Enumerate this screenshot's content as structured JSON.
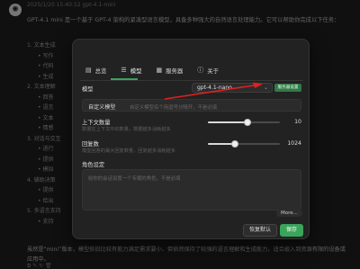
{
  "chat": {
    "meta": "2025/1/20 15:40:12   gpt-4.1-mini",
    "intro": "GPT-4.1 mini 是一个基于 GPT-4 架构的紧凑型语言模型，具备多种强大的自然语言处理能力。它可以帮助你完成以下任务：",
    "section_items": [
      "1. 文本生成",
      "• 写作",
      "• 代码",
      "• 生成",
      "2. 文本理解",
      "• 回答",
      "• 语言",
      "• 文本",
      "• 情感",
      "3. 对话与交互",
      "• 进行",
      "• 提供",
      "• 模拟",
      "4. 辅助决策",
      "• 提供",
      "• 给出",
      "5. 多语言支持",
      "• 支持"
    ],
    "outro": "虽然是“mini”版本，模型依旧比较有能力满足需求要小、但依然保持了较强的语言理解和生成能力，适合嵌入到资源有限的设备或应用中。"
  },
  "dialog": {
    "tabs": [
      {
        "label": "总览",
        "icon": "file-icon"
      },
      {
        "label": "模型",
        "icon": "sliders-icon"
      },
      {
        "label": "服务器",
        "icon": "server-icon"
      },
      {
        "label": "关于",
        "icon": "info-icon"
      }
    ],
    "active_tab": "模型",
    "model_label": "模型",
    "model_value": "gpt-4.1-nano",
    "api_badge": "服务器设置",
    "custom_model_label": "自定义模型",
    "custom_model_placeholder": "自定义模型名个用逗号分隔开，不是必填",
    "context_label": "上下文数量",
    "context_hint": "数据在上下文中的数量，数据越多消耗越多",
    "context_value": "10",
    "context_fraction": 0.55,
    "reply_label": "回复数",
    "reply_hint": "模型回答的最大回复数量，回复越多消耗越多",
    "reply_value": "1024",
    "reply_fraction": 0.38,
    "role_label": "角色设定",
    "role_placeholder": "给你的会话设置一个专属的角色，不是必填",
    "more_label": "More...",
    "reset_label": "恢复默认",
    "save_label": "保存"
  },
  "colors": {
    "accent": "#3aa45b",
    "annotation": "#e02020"
  }
}
